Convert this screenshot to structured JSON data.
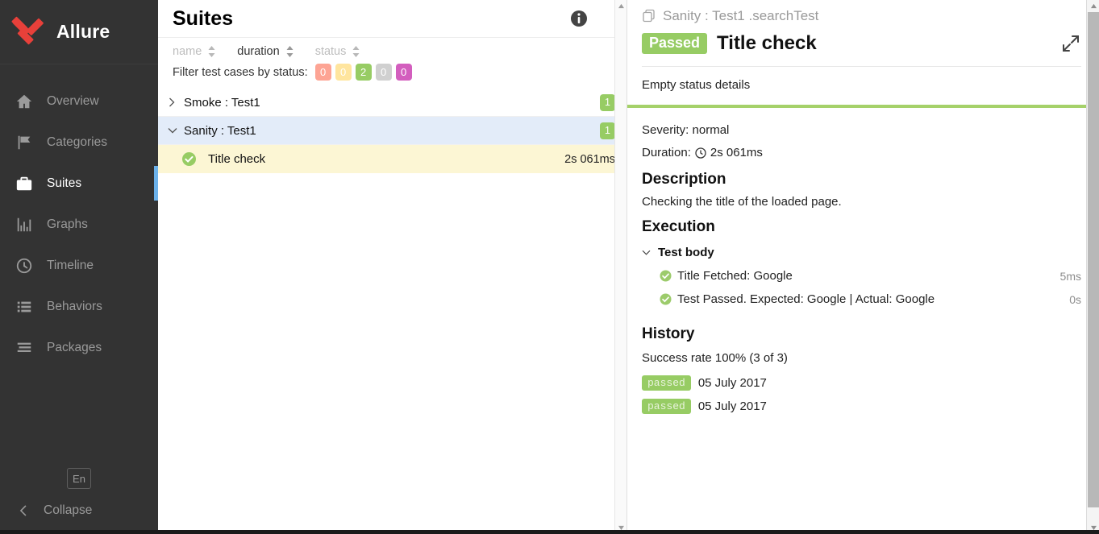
{
  "sidebar": {
    "brand": "Allure",
    "items": [
      {
        "label": "Overview",
        "icon": "home-icon",
        "active": false
      },
      {
        "label": "Categories",
        "icon": "flag-icon",
        "active": false
      },
      {
        "label": "Suites",
        "icon": "briefcase-icon",
        "active": true
      },
      {
        "label": "Graphs",
        "icon": "bar-chart-icon",
        "active": false
      },
      {
        "label": "Timeline",
        "icon": "clock-icon",
        "active": false
      },
      {
        "label": "Behaviors",
        "icon": "list-icon",
        "active": false
      },
      {
        "label": "Packages",
        "icon": "stack-icon",
        "active": false
      }
    ],
    "language": "En",
    "collapse": "Collapse"
  },
  "tree": {
    "title": "Suites",
    "info_icon": "info-icon",
    "sorts": [
      {
        "label": "name",
        "active": false
      },
      {
        "label": "duration",
        "active": true
      },
      {
        "label": "status",
        "active": false
      }
    ],
    "filter_label": "Filter test cases by status:",
    "status_filters": [
      {
        "count": "0",
        "status": "failed",
        "color": "#fd5a3e"
      },
      {
        "count": "0",
        "status": "broken",
        "color": "#ffd050"
      },
      {
        "count": "2",
        "status": "passed",
        "color": "#97cc64"
      },
      {
        "count": "0",
        "status": "skipped",
        "color": "#aaaaaa"
      },
      {
        "count": "0",
        "status": "unknown",
        "color": "#d35ebe"
      }
    ],
    "rows": [
      {
        "label": "Smoke : Test1",
        "count": "1",
        "expanded": false,
        "selected": false
      },
      {
        "label": "Sanity : Test1",
        "count": "1",
        "expanded": true,
        "selected": true
      }
    ],
    "leaf": {
      "label": "Title check",
      "duration": "2s 061ms",
      "status": "passed"
    }
  },
  "detail": {
    "breadcrumb": "Sanity : Test1 .searchTest",
    "status_tag": "Passed",
    "title": "Title check",
    "expand_icon": "expand-icon",
    "status_details": "Empty status details",
    "severity": "Severity: normal",
    "duration_label": "Duration:",
    "duration_value": "2s 061ms",
    "description_heading": "Description",
    "description_text": "Checking the title of the loaded page.",
    "execution_heading": "Execution",
    "test_body_label": "Test body",
    "steps": [
      {
        "text": "Title Fetched: Google",
        "duration": "5ms",
        "status": "passed"
      },
      {
        "text": "Test Passed. Expected: Google | Actual: Google",
        "duration": "0s",
        "status": "passed"
      }
    ],
    "history_heading": "History",
    "history_rate": "Success rate 100% (3 of 3)",
    "history_entries": [
      {
        "status": "passed",
        "date": "05 July 2017"
      },
      {
        "status": "passed",
        "date": "05 July 2017"
      }
    ]
  },
  "colors": {
    "accent_green": "#97cc64",
    "selection_blue": "#e3ecf9",
    "leaf_yellow": "#fcf6d4",
    "sidebar_bg": "#333333",
    "active_indicator": "#6cb2eb"
  }
}
